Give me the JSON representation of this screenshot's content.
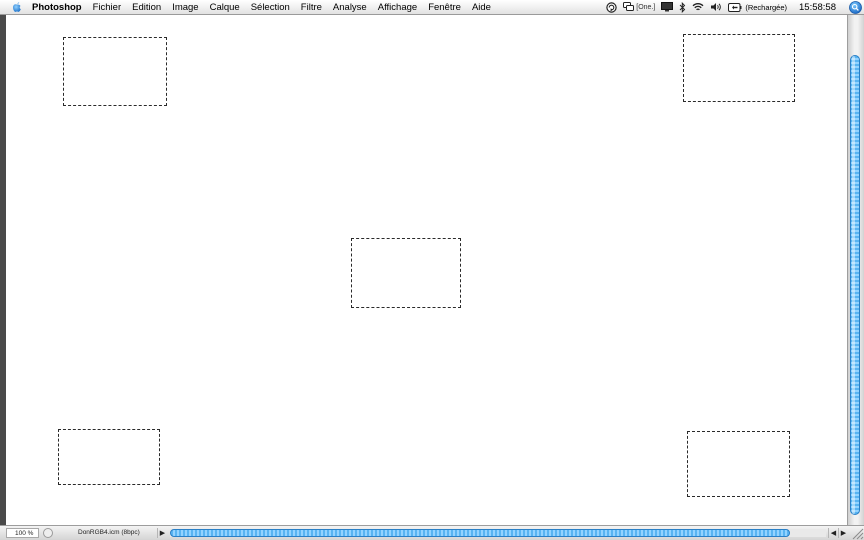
{
  "menubar": {
    "app_name": "Photoshop",
    "items": [
      "Fichier",
      "Edition",
      "Image",
      "Calque",
      "Sélection",
      "Filtre",
      "Analyse",
      "Affichage",
      "Fenêtre",
      "Aide"
    ],
    "status": {
      "one_label": "[One.]",
      "battery_label": "(Rechargée)",
      "clock": "15:58:58"
    }
  },
  "statusbar": {
    "zoom": "100 %",
    "document_profile": "DonRGB4.icm (8bpc)"
  },
  "scrollbars": {
    "accent_color": "#58b4f2"
  }
}
